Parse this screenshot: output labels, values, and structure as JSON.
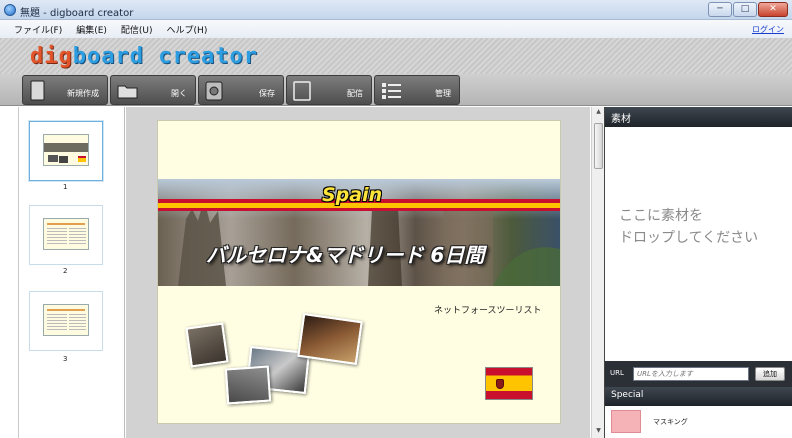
{
  "window": {
    "title": "無題 - digboard creator",
    "buttons": [
      "─",
      "□",
      "✕"
    ]
  },
  "menu": {
    "items": [
      "ファイル(F)",
      "編集(E)",
      "配信(U)",
      "ヘルプ(H)"
    ],
    "login": "ログイン"
  },
  "brand": {
    "logo_prefix": "dig",
    "logo_rest": "board creator"
  },
  "toolbar": {
    "buttons": [
      {
        "label": "新規作成",
        "icon": "new-document-icon"
      },
      {
        "label": "開く",
        "icon": "folder-icon"
      },
      {
        "label": "保存",
        "icon": "save-icon"
      },
      {
        "label": "配信",
        "icon": "publish-icon"
      },
      {
        "label": "管理",
        "icon": "list-icon"
      }
    ]
  },
  "thumbnails": [
    {
      "page": "1",
      "selected": true
    },
    {
      "page": "2",
      "selected": false
    },
    {
      "page": "3",
      "selected": false
    }
  ],
  "slide": {
    "banner_word": "Spain",
    "banner_title": "バルセロナ&マドリード 6日間",
    "company": "ネットフォースツーリスト",
    "photos": 4
  },
  "materials": {
    "header": "素材",
    "drop_text_line1": "ここに素材を",
    "drop_text_line2": "ドロップしてください",
    "url_label": "URL",
    "url_placeholder": "URLを入力します",
    "add_button": "追加",
    "special_header": "Special",
    "special_items": [
      {
        "label": "マスキング",
        "color": "#f5b3b8"
      }
    ]
  },
  "colors": {
    "accent_blue": "#2b9de0",
    "accent_orange": "#e2552b",
    "panel_dark": "#1e2329",
    "slide_bg": "#fffee3"
  }
}
